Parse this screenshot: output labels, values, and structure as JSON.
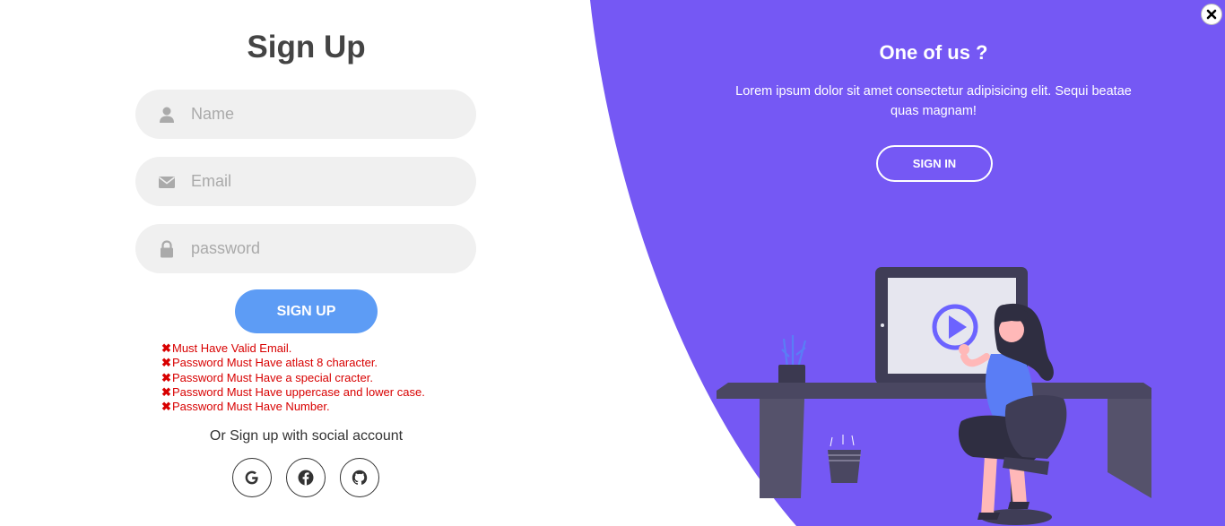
{
  "signup": {
    "title": "Sign Up",
    "name_placeholder": "Name",
    "email_placeholder": "Email",
    "password_placeholder": "password",
    "button_label": "SIGN UP",
    "errors": [
      "Must Have Valid Email.",
      "Password Must Have atlast 8 character.",
      "Password Must Have a special cracter.",
      "Password Must Have uppercase and lower case.",
      "Password Must Have Number."
    ],
    "error_mark": "✖",
    "social_text": "Or Sign up with social account",
    "social_icons": [
      "google-icon",
      "facebook-icon",
      "github-icon"
    ]
  },
  "panel": {
    "title": "One of us ?",
    "text": "Lorem ipsum dolor sit amet consectetur adipisicing elit. Sequi beatae quas magnam!",
    "button_label": "SIGN IN"
  },
  "colors": {
    "accent_purple": "#7558f4",
    "signup_button": "#5d9cf5",
    "error_red": "#d80000"
  }
}
